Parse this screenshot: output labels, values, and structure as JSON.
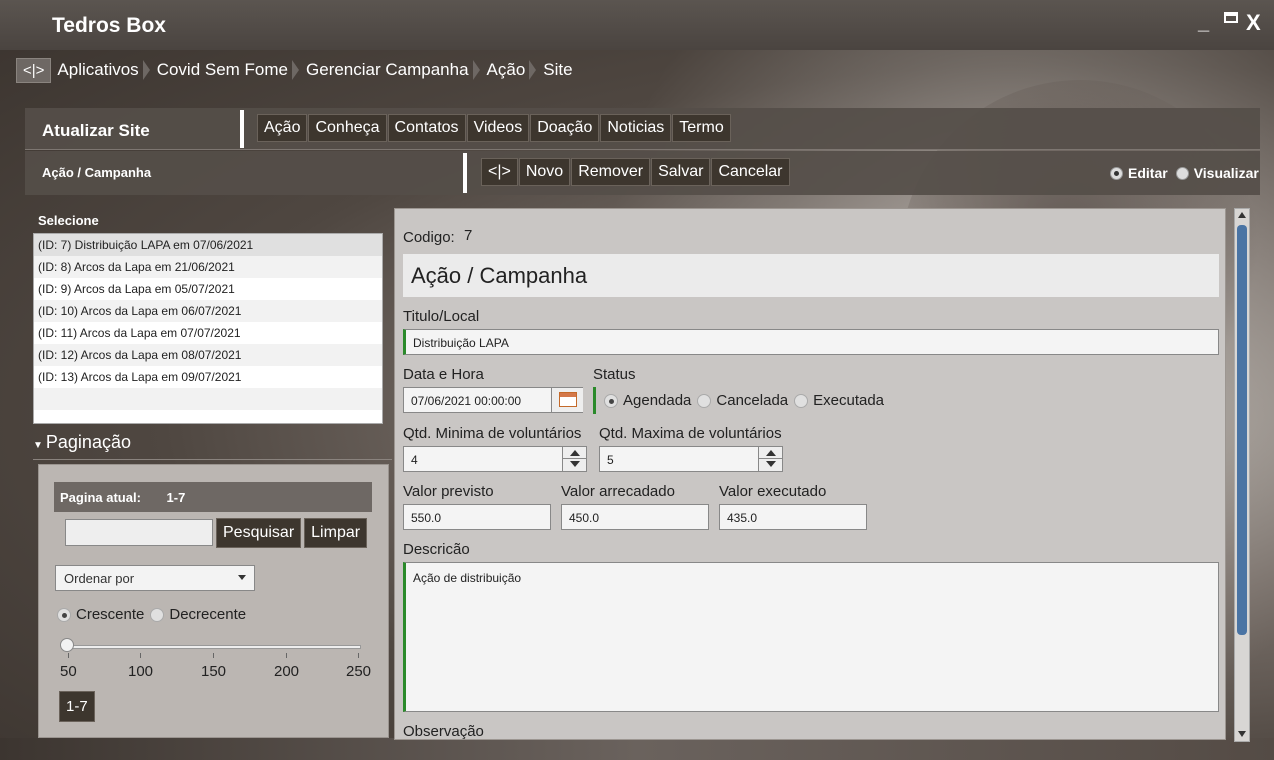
{
  "app": {
    "title": "Tedros Box",
    "min": "_",
    "close": "X"
  },
  "breadcrumb": {
    "home": "<|>",
    "items": [
      "Aplicativos",
      "Covid Sem Fome",
      "Gerenciar Campanha",
      "Ação",
      "Site"
    ]
  },
  "header": {
    "title": "Atualizar Site",
    "tabs": [
      "Ação",
      "Conheça",
      "Contatos",
      "Videos",
      "Doação",
      "Noticias",
      "Termo"
    ]
  },
  "subheader": {
    "title": "Ação / Campanha",
    "toolbar": [
      "<|>",
      "Novo",
      "Remover",
      "Salvar",
      "Cancelar"
    ],
    "modes": {
      "edit": "Editar",
      "view": "Visualizar",
      "selected": "Editar"
    }
  },
  "list": {
    "label": "Selecione",
    "items": [
      "(ID: 7) Distribuição LAPA em 07/06/2021",
      "(ID: 8) Arcos da Lapa  em 21/06/2021",
      "(ID: 9) Arcos da Lapa  em 05/07/2021",
      "(ID: 10) Arcos da Lapa em 06/07/2021",
      "(ID: 11) Arcos da Lapa em 07/07/2021",
      "(ID: 12) Arcos da Lapa em 08/07/2021",
      "(ID: 13) Arcos da Lapa em 09/07/2021"
    ]
  },
  "pagination": {
    "header": "Paginação",
    "current_label": "Pagina atual:",
    "current_value": "1-7",
    "search_button": "Pesquisar",
    "clear_button": "Limpar",
    "order_placeholder": "Ordenar por",
    "asc": "Crescente",
    "desc": "Decrecente",
    "slider_labels": [
      "50",
      "100",
      "150",
      "200",
      "250"
    ],
    "slider_value": 50,
    "range_button": "1-7"
  },
  "form": {
    "codigo_label": "Codigo:",
    "codigo_value": "7",
    "section_title": "Ação / Campanha",
    "titulo_label": "Titulo/Local",
    "titulo_value": "Distribuição LAPA",
    "datahora_label": "Data e Hora",
    "datahora_value": "07/06/2021 00:00:00",
    "status_label": "Status",
    "status_options": [
      "Agendada",
      "Cancelada",
      "Executada"
    ],
    "status_selected": "Agendada",
    "qtd_min_label": "Qtd. Minima de voluntários",
    "qtd_min_value": "4",
    "qtd_max_label": "Qtd. Maxima de voluntários",
    "qtd_max_value": "5",
    "valor_previsto_label": "Valor previsto",
    "valor_previsto_value": "550.0",
    "valor_arrecadado_label": "Valor arrecadado",
    "valor_arrecadado_value": "450.0",
    "valor_executado_label": "Valor executado",
    "valor_executado_value": "435.0",
    "descricao_label": "Descricão",
    "descricao_value": "Ação de distribuição",
    "observacao_label": "Observação"
  },
  "icons": {
    "calendar": "calendar-icon",
    "spinner": "spinner-icon",
    "chevron": "chevron-down-icon"
  }
}
